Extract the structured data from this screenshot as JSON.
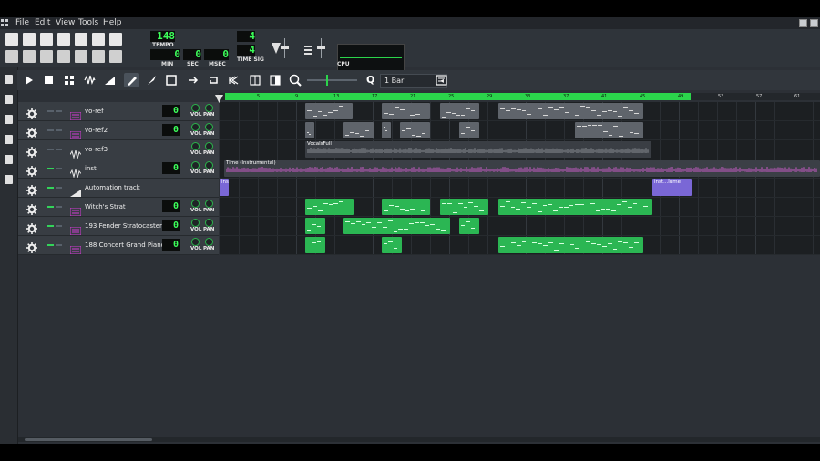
{
  "menubar": {
    "items": [
      "File",
      "Edit",
      "View",
      "Tools",
      "Help"
    ]
  },
  "transport": {
    "tempo": "148",
    "tempo_label": "TEMPO",
    "min": "0",
    "sec": "0",
    "msec": "0",
    "min_label": "MIN",
    "sec_label": "SEC",
    "msec_label": "MSEC",
    "timesig_num": "4",
    "timesig_den": "4",
    "timesig_label": "TIME SIG",
    "cpu_label": "CPU"
  },
  "song_editor": {
    "snap_value": "1 Bar",
    "snap_icon": "Q"
  },
  "timeline": {
    "bars": [
      "5",
      "9",
      "13",
      "17",
      "21",
      "25",
      "29",
      "33",
      "37",
      "41",
      "45",
      "49",
      "53",
      "57",
      "61"
    ],
    "loop_color": "#2bd44b"
  },
  "tracks": [
    {
      "name": "vo-ref",
      "type": "instrument",
      "volume": "0",
      "vol_label": "VOL",
      "pan_label": "PAN",
      "muted_active": false
    },
    {
      "name": "vo-ref2",
      "type": "instrument",
      "volume": "0",
      "vol_label": "VOL",
      "pan_label": "PAN",
      "muted_active": false
    },
    {
      "name": "vo-ref3",
      "type": "sample",
      "volume": "",
      "vol_label": "VOL",
      "pan_label": "PAN",
      "muted_active": false
    },
    {
      "name": "inst",
      "type": "sample",
      "volume": "0",
      "vol_label": "VOL",
      "pan_label": "PAN",
      "muted_active": true
    },
    {
      "name": "Automation track",
      "type": "automation",
      "volume": "",
      "vol_label": "",
      "pan_label": "",
      "muted_active": true
    },
    {
      "name": "Witch's Strat",
      "type": "instrument",
      "volume": "0",
      "vol_label": "VOL",
      "pan_label": "PAN",
      "muted_active": true
    },
    {
      "name": "193 Fender Stratocaster",
      "type": "instrument",
      "volume": "0",
      "vol_label": "VOL",
      "pan_label": "PAN",
      "muted_active": true
    },
    {
      "name": "188 Concert Grand Piano",
      "type": "instrument",
      "volume": "0",
      "vol_label": "VOL",
      "pan_label": "PAN",
      "muted_active": true
    }
  ],
  "clip_labels": {
    "vocals": "VocalsFull",
    "instrumental": "Time (Instrumental)",
    "auto_start": "ins",
    "auto_end": "inst...lume"
  },
  "colors": {
    "accent_green": "#2bb653",
    "lcd_green": "#3cff5a",
    "automation": "#7a67d6",
    "waveform_pink": "#c85ec8"
  }
}
